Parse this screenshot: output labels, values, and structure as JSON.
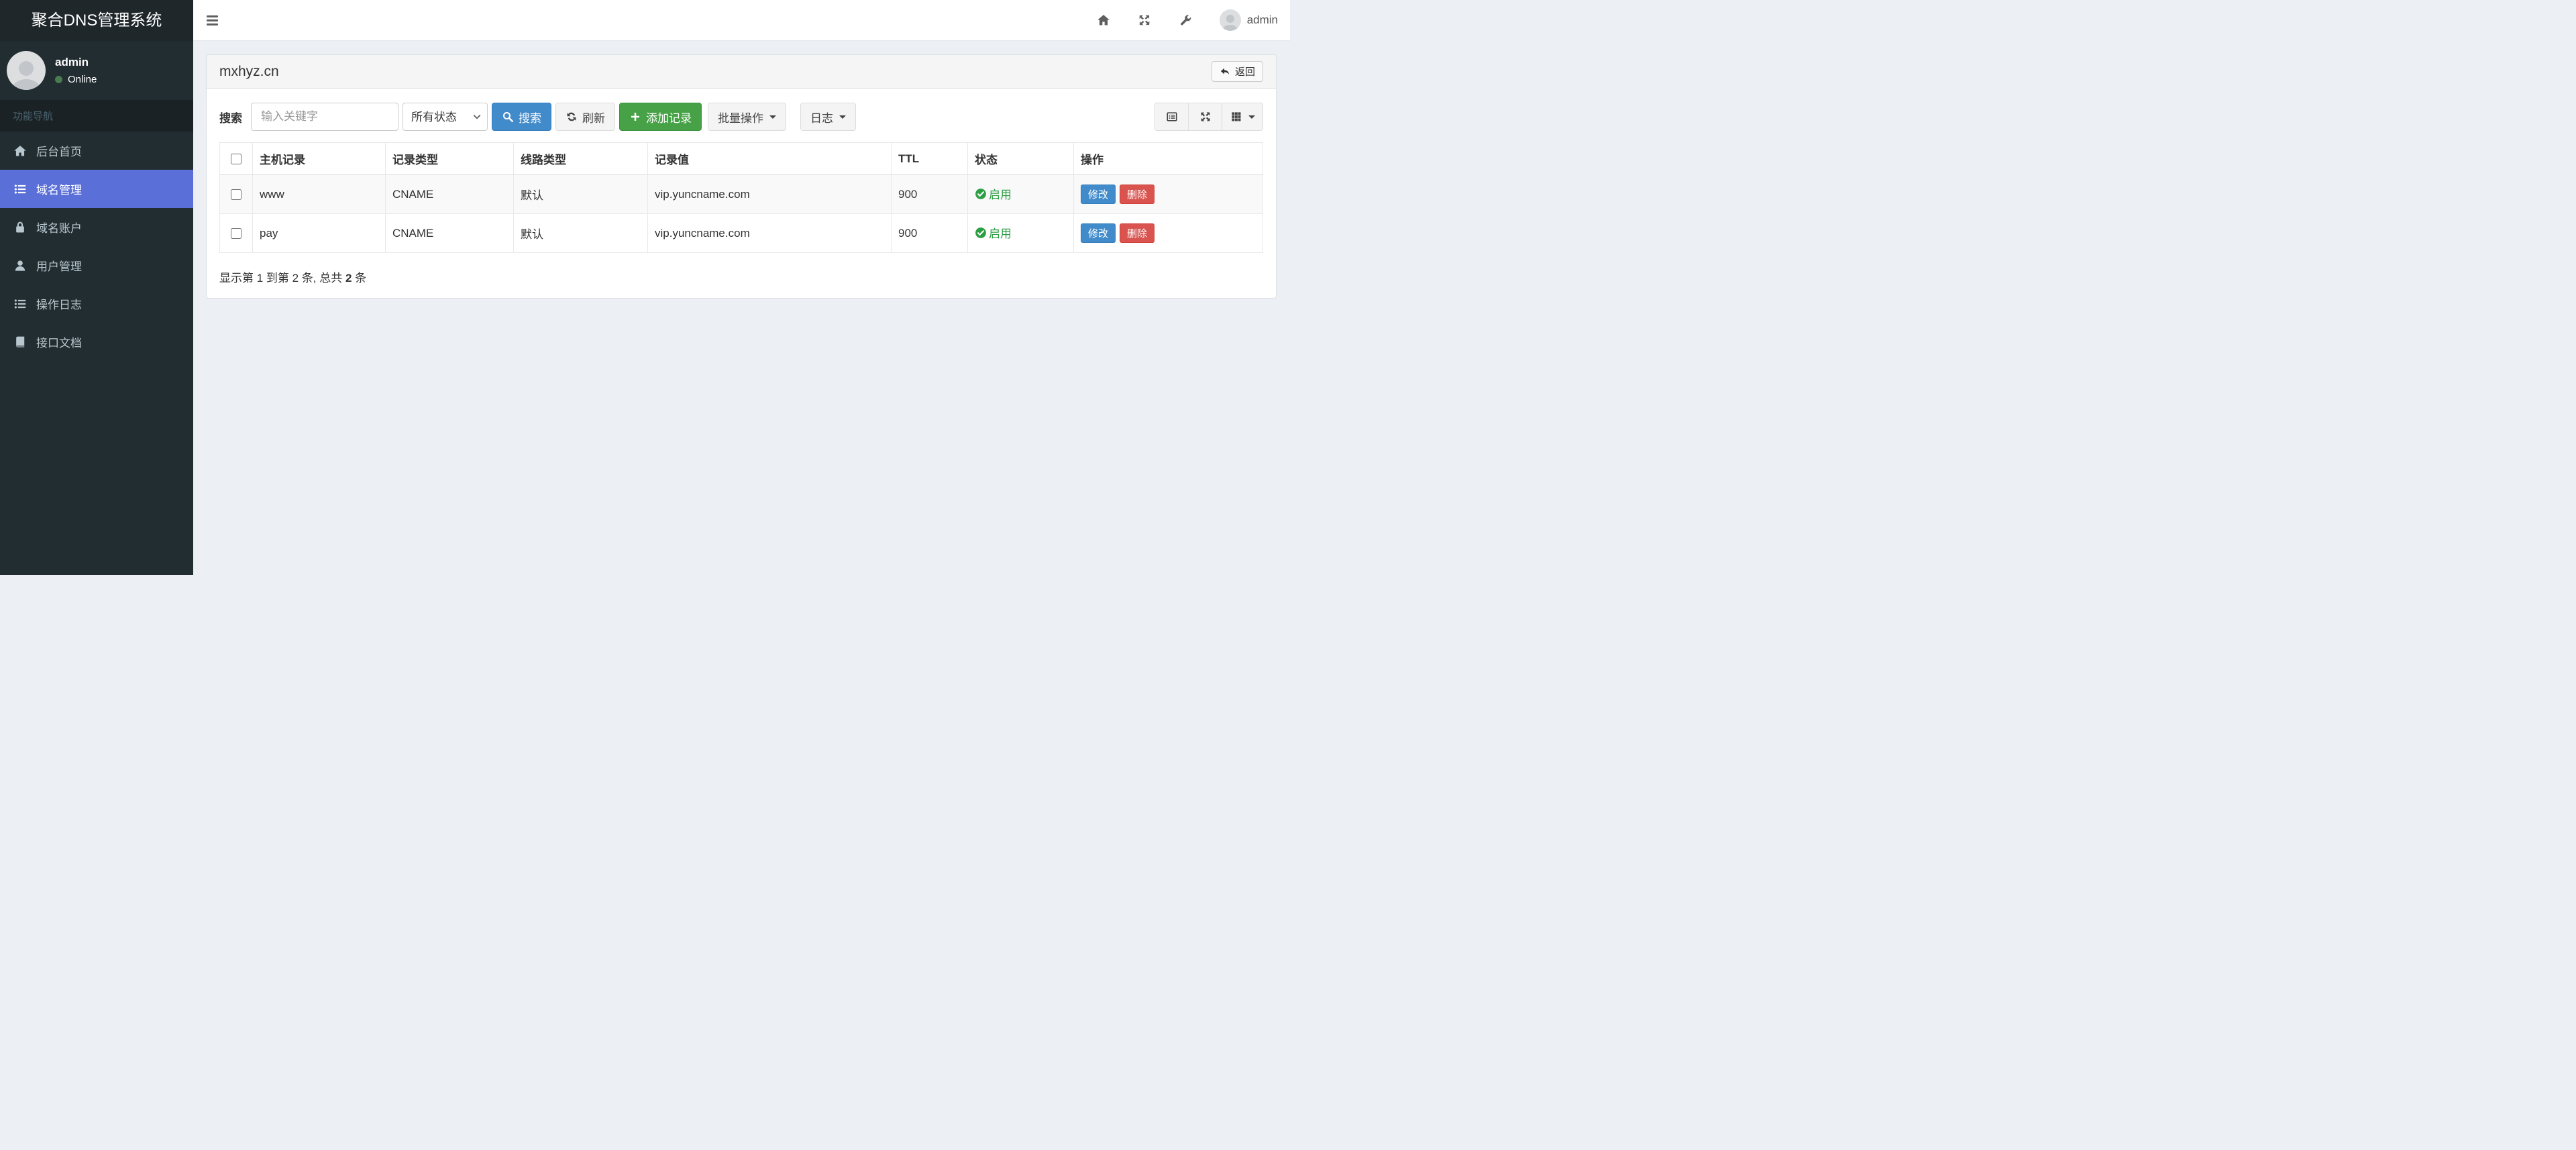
{
  "app": {
    "title": "聚合DNS管理系统"
  },
  "topbar": {
    "menu_icon": "hamburger-icon",
    "icons": [
      "home-icon",
      "expand-icon",
      "wrench-icon"
    ],
    "user_name": "admin",
    "avatar_icon": "user-avatar"
  },
  "sidebar": {
    "user": {
      "name": "admin",
      "status": "Online"
    },
    "section_label": "功能导航",
    "items": [
      {
        "label": "后台首页",
        "icon": "home-icon",
        "active": false
      },
      {
        "label": "域名管理",
        "icon": "list-icon",
        "active": true
      },
      {
        "label": "域名账户",
        "icon": "lock-icon",
        "active": false
      },
      {
        "label": "用户管理",
        "icon": "user-icon",
        "active": false
      },
      {
        "label": "操作日志",
        "icon": "log-list-icon",
        "active": false
      },
      {
        "label": "接口文档",
        "icon": "book-icon",
        "active": false
      }
    ]
  },
  "panel": {
    "title": "mxhyz.cn",
    "back_button": "返回",
    "toolbar": {
      "search_label": "搜索",
      "search_placeholder": "输入关键字",
      "status_select_value": "所有状态",
      "search_button": "搜索",
      "refresh_button": "刷新",
      "add_button": "添加记录",
      "batch_button": "批量操作",
      "log_button": "日志",
      "view_icons": [
        "list-alt-icon",
        "fullscreen-icon",
        "columns-grid-icon"
      ]
    },
    "table": {
      "columns": [
        "主机记录",
        "记录类型",
        "线路类型",
        "记录值",
        "TTL",
        "状态",
        "操作"
      ],
      "rows": [
        {
          "host": "www",
          "type": "CNAME",
          "line": "默认",
          "value": "vip.yuncname.com",
          "ttl": "900",
          "status": "启用",
          "actions": [
            "修改",
            "删除"
          ]
        },
        {
          "host": "pay",
          "type": "CNAME",
          "line": "默认",
          "value": "vip.yuncname.com",
          "ttl": "900",
          "status": "启用",
          "actions": [
            "修改",
            "删除"
          ]
        }
      ],
      "summary_prefix": "显示第 1 到第 2 条, 总共 ",
      "summary_total": "2",
      "summary_suffix": " 条"
    }
  },
  "colors": {
    "sidebar-bg": "#222d32",
    "active-bg": "#5b6fd9",
    "primary": "#428bca",
    "success": "#47a247",
    "danger": "#d9534f",
    "status-green": "#2e9e45",
    "content-bg": "#ecf0f5"
  }
}
